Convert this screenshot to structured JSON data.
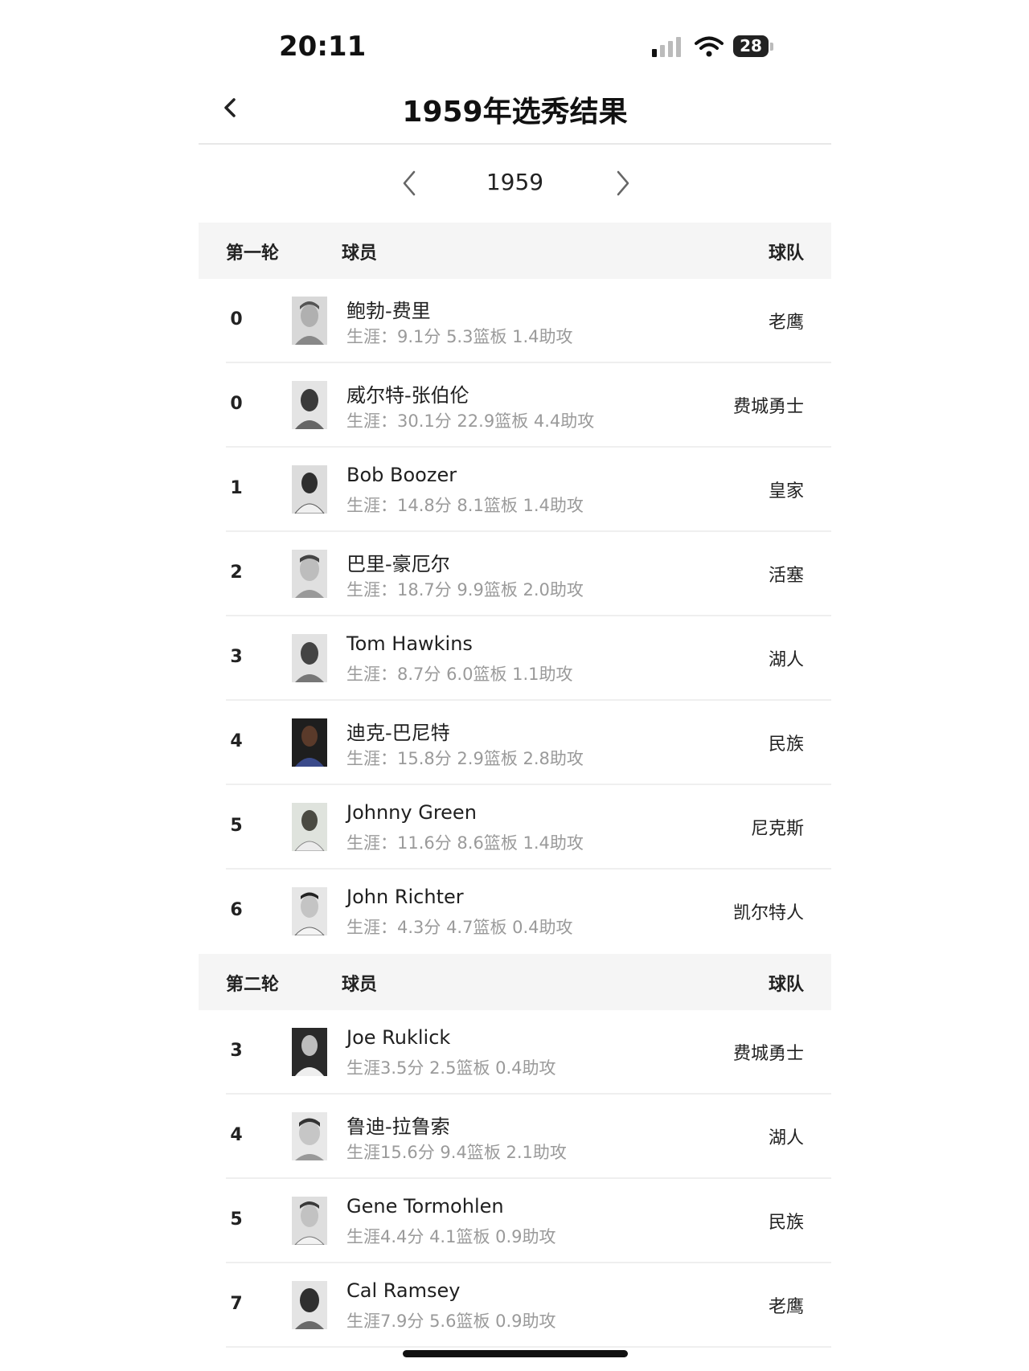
{
  "status": {
    "time": "20:11",
    "battery": "28"
  },
  "nav": {
    "title": "1959年选秀结果"
  },
  "year_selector": {
    "year": "1959"
  },
  "rounds": [
    {
      "label": "第一轮",
      "player_col": "球员",
      "team_col": "球队",
      "rows": [
        {
          "pick": "0",
          "name": "鲍勃-费里",
          "stats": "生涯：9.1分 5.3篮板 1.4助攻",
          "team": "老鹰"
        },
        {
          "pick": "0",
          "name": "威尔特-张伯伦",
          "stats": "生涯：30.1分 22.9篮板 4.4助攻",
          "team": "费城勇士"
        },
        {
          "pick": "1",
          "name": "Bob Boozer",
          "stats": "生涯：14.8分 8.1篮板 1.4助攻",
          "team": "皇家"
        },
        {
          "pick": "2",
          "name": "巴里-豪厄尔",
          "stats": "生涯：18.7分 9.9篮板 2.0助攻",
          "team": "活塞"
        },
        {
          "pick": "3",
          "name": "Tom Hawkins",
          "stats": "生涯：8.7分 6.0篮板 1.1助攻",
          "team": "湖人"
        },
        {
          "pick": "4",
          "name": "迪克-巴尼特",
          "stats": "生涯：15.8分 2.9篮板 2.8助攻",
          "team": "民族"
        },
        {
          "pick": "5",
          "name": "Johnny Green",
          "stats": "生涯：11.6分 8.6篮板 1.4助攻",
          "team": "尼克斯"
        },
        {
          "pick": "6",
          "name": "John Richter",
          "stats": "生涯：4.3分 4.7篮板 0.4助攻",
          "team": "凯尔特人"
        }
      ]
    },
    {
      "label": "第二轮",
      "player_col": "球员",
      "team_col": "球队",
      "rows": [
        {
          "pick": "3",
          "name": "Joe Ruklick",
          "stats": "生涯3.5分 2.5篮板 0.4助攻",
          "team": "费城勇士"
        },
        {
          "pick": "4",
          "name": "鲁迪-拉鲁索",
          "stats": "生涯15.6分 9.4篮板 2.1助攻",
          "team": "湖人"
        },
        {
          "pick": "5",
          "name": "Gene Tormohlen",
          "stats": "生涯4.4分 4.1篮板 0.9助攻",
          "team": "民族"
        },
        {
          "pick": "7",
          "name": "Cal Ramsey",
          "stats": "生涯7.9分 5.6篮板 0.9助攻",
          "team": "老鹰"
        }
      ]
    }
  ]
}
